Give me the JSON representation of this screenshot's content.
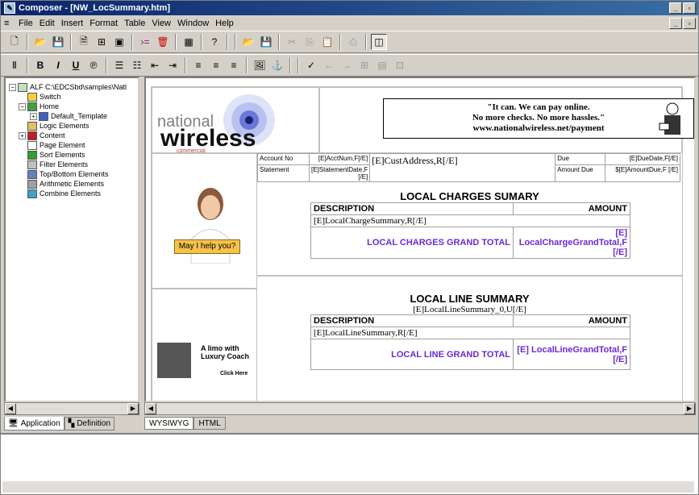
{
  "window": {
    "title": "Composer - [NW_LocSummary.htm]"
  },
  "menu": [
    "File",
    "Edit",
    "Insert",
    "Format",
    "Table",
    "View",
    "Window",
    "Help"
  ],
  "toolbar1": [
    "new-doc-icon",
    "open-folder-icon",
    "save-icon",
    "new-page-icon",
    "tree-add-icon",
    "page-icon",
    "arrow-icon",
    "delete-icon",
    "grid-icon",
    "help-icon",
    "open-icon",
    "save-disabled-icon",
    "cut-icon",
    "copy-icon",
    "paste-icon",
    "print-icon",
    "preview-icon"
  ],
  "toolbar2": [
    "style-icon",
    "bold-icon",
    "italic-icon",
    "underline-icon",
    "spell-icon",
    "ordered-list-icon",
    "bullet-list-icon",
    "outdent-icon",
    "indent-icon",
    "align-left-icon",
    "align-center-icon",
    "align-right-icon",
    "image-icon",
    "anchor-icon",
    "picker-icon",
    "back-icon",
    "forward-icon",
    "table-icon",
    "cell-icon",
    "frame-icon"
  ],
  "tree": {
    "root": "ALF C:\\EDCSbd\\samples\\Natl",
    "items": [
      {
        "label": "Switch",
        "level": 1,
        "icon": "switch-icon",
        "exp": ""
      },
      {
        "label": "Home",
        "level": 1,
        "icon": "home-icon",
        "exp": "−"
      },
      {
        "label": "Default_Template",
        "level": 2,
        "icon": "template-icon",
        "exp": "+"
      },
      {
        "label": "Logic Elements",
        "level": 1,
        "icon": "logic-icon",
        "exp": ""
      },
      {
        "label": "Content",
        "level": 1,
        "icon": "content-icon",
        "exp": "+"
      },
      {
        "label": "Page Element",
        "level": 1,
        "icon": "page-element-icon",
        "exp": ""
      },
      {
        "label": "Sort Elements",
        "level": 1,
        "icon": "sort-icon",
        "exp": ""
      },
      {
        "label": "Filter Elements",
        "level": 1,
        "icon": "filter-icon",
        "exp": ""
      },
      {
        "label": "Top/Bottom Elements",
        "level": 1,
        "icon": "top-bottom-icon",
        "exp": ""
      },
      {
        "label": "Arithmetic Elements",
        "level": 1,
        "icon": "arithmetic-icon",
        "exp": ""
      },
      {
        "label": "Combine Elements",
        "level": 1,
        "icon": "combine-icon",
        "exp": ""
      }
    ]
  },
  "left_tabs": {
    "application": "Application",
    "definition": "Definition"
  },
  "right_tabs": {
    "wysiwyg": "WYSIWYG",
    "html": "HTML"
  },
  "template": {
    "logo": {
      "top": "national",
      "big": "wireless",
      "sub": "commercial"
    },
    "ad": {
      "line1": "\"It can. We can pay online.",
      "line2": "No more checks. No more hassles.\"",
      "line3": "www.nationalwireless.net/payment"
    },
    "help_button": "May I help you?",
    "limo": {
      "line1": "A limo with",
      "line2": "Luxury Coach",
      "link": "Click Here"
    },
    "account": {
      "acct_label": "Account No",
      "acct_value": "[E]AcctNum,F[/E]",
      "address_value": "[E]CustAddress,R[/E]",
      "due_label": "Due",
      "due_value": "[E]DueDate,F[/E]",
      "stmt_label": "Statement",
      "stmt_value": "[E]StatementDate,F [/E]",
      "amt_label": "Amount Due",
      "amt_value": "$[E]AmountDue,F [/E]"
    },
    "local_charges": {
      "title": "LOCAL CHARGES SUMARY",
      "desc": "DESCRIPTION",
      "amount": "AMOUNT",
      "row": "[E]LocalChargeSummary,R[/E]",
      "total_label": "LOCAL CHARGES GRAND TOTAL",
      "total_value": "[E] LocalChargeGrandTotal,F [/E]"
    },
    "local_line": {
      "title": "LOCAL LINE SUMMARY",
      "subtitle": "[E]LocalLineSummary_0,U[/E]",
      "desc": "DESCRIPTION",
      "amount": "AMOUNT",
      "row": "[E]LocalLineSummary,R[/E]",
      "total_label": "LOCAL LINE GRAND TOTAL",
      "total_value": "[E] LocalLineGrandTotal,F [/E]"
    }
  },
  "colors": {
    "title_gradient_start": "#0a246a",
    "purple_text": "#6a2ad9",
    "help_button": "#f7c24b"
  }
}
